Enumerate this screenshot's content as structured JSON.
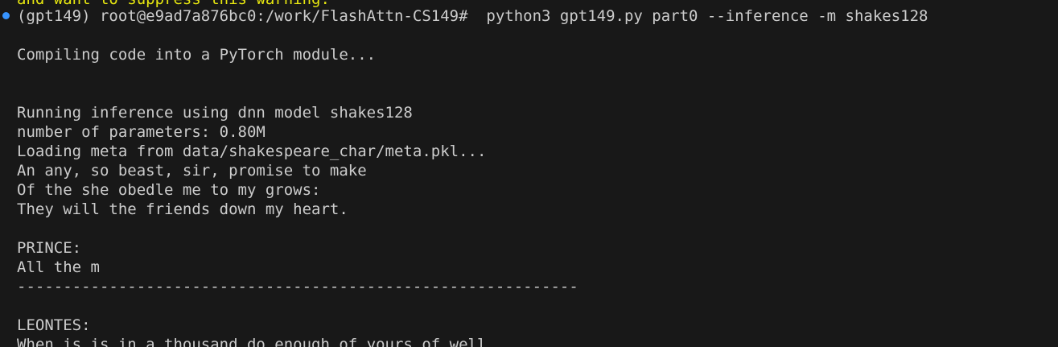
{
  "colors": {
    "background": "#181818",
    "text": "#cccccc",
    "warning": "#e5e510",
    "prompt_marker": "#3794ff"
  },
  "warning_line": "and want to suppress this warning.",
  "prompt": {
    "marker_icon": "circle-icon",
    "text": "(gpt149) root@e9ad7a876bc0:/work/FlashAttn-CS149#  python3 gpt149.py part0 --inference -m shakes128"
  },
  "output": [
    "Compiling code into a PyTorch module...",
    "",
    "",
    "Running inference using dnn model shakes128",
    "number of parameters: 0.80M",
    "Loading meta from data/shakespeare_char/meta.pkl...",
    "An any, so beast, sir, promise to make",
    "Of the she obedle me to my grows:",
    "They will the friends down my heart.",
    "",
    "PRINCE:",
    "All the m",
    "-------------------------------------------------------------",
    "",
    "LEONTES:",
    "When is is in a thousand do enough of yours of well"
  ]
}
